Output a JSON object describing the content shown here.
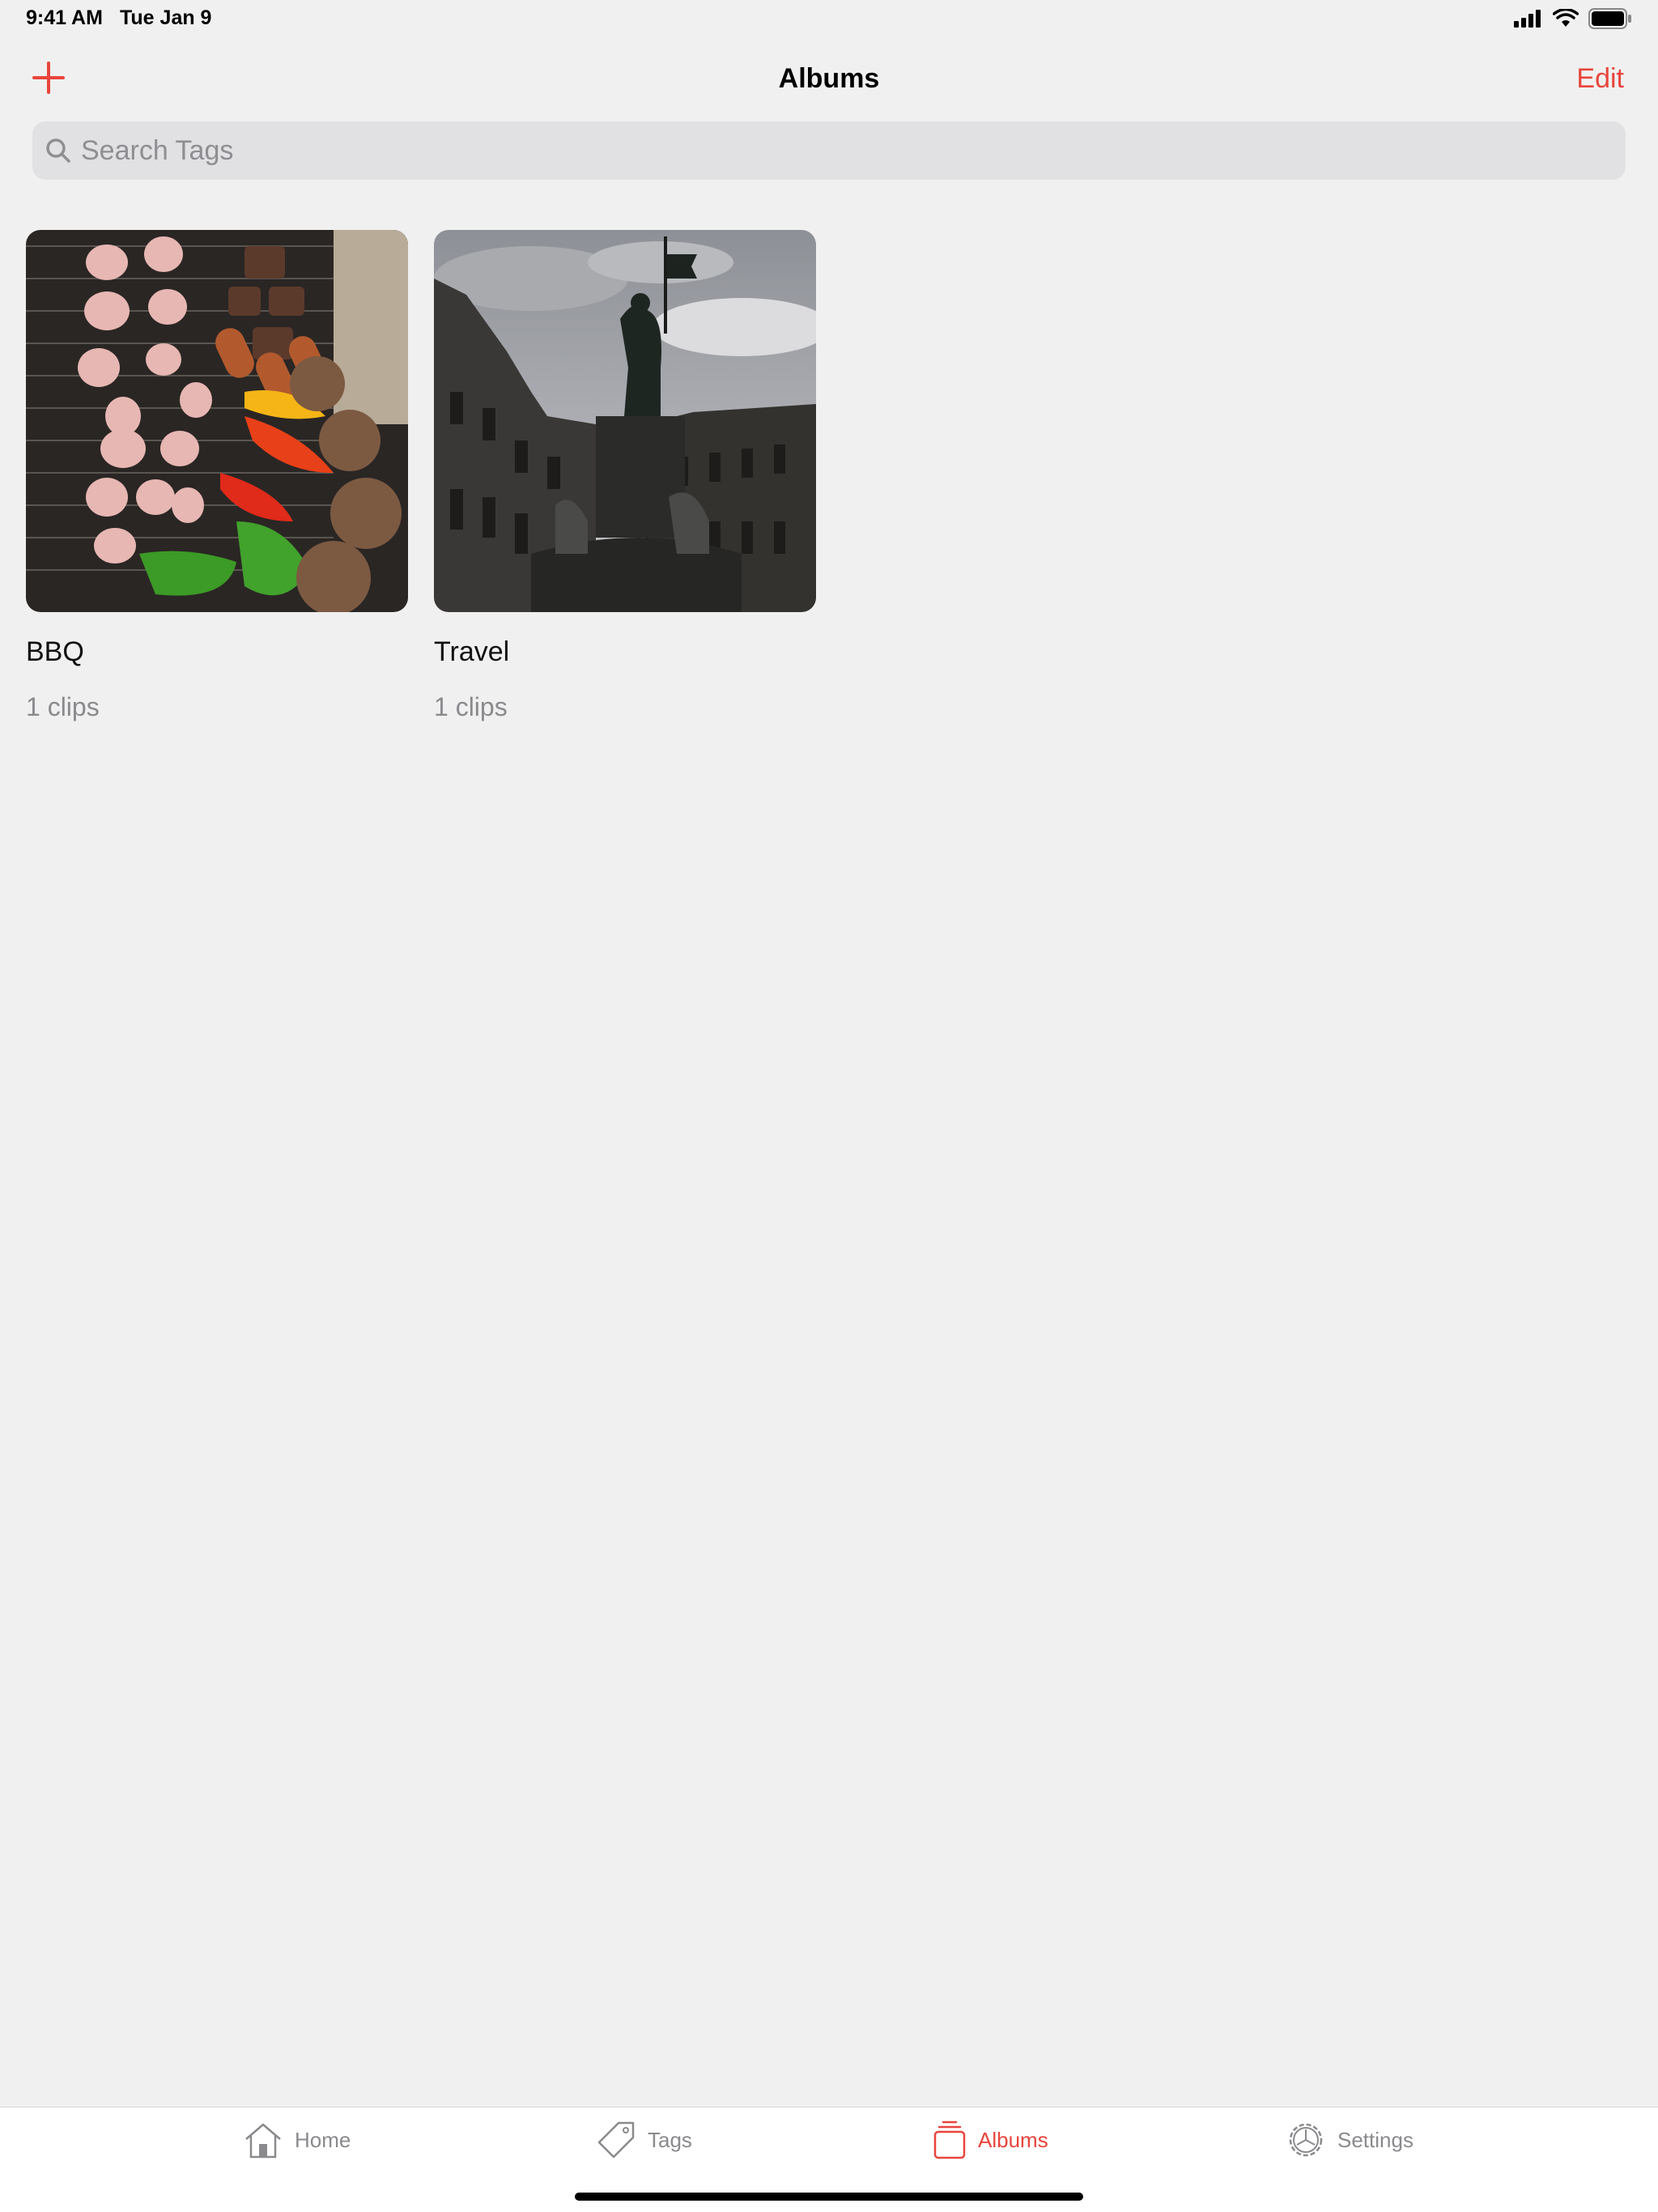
{
  "status_bar": {
    "time": "9:41 AM",
    "date": "Tue Jan 9"
  },
  "nav": {
    "title": "Albums",
    "edit_label": "Edit",
    "add_icon": "plus-icon"
  },
  "search": {
    "placeholder": "Search Tags",
    "value": ""
  },
  "albums": [
    {
      "title": "BBQ",
      "count": "1 clips"
    },
    {
      "title": "Travel",
      "count": "1 clips"
    }
  ],
  "tabs": [
    {
      "label": "Home",
      "icon": "home-icon",
      "active": false
    },
    {
      "label": "Tags",
      "icon": "tag-icon",
      "active": false
    },
    {
      "label": "Albums",
      "icon": "albums-icon",
      "active": true
    },
    {
      "label": "Settings",
      "icon": "settings-icon",
      "active": false
    }
  ],
  "colors": {
    "accent": "#e8453c",
    "background": "#f0f0f0",
    "secondary_text": "#8a8a8e"
  }
}
